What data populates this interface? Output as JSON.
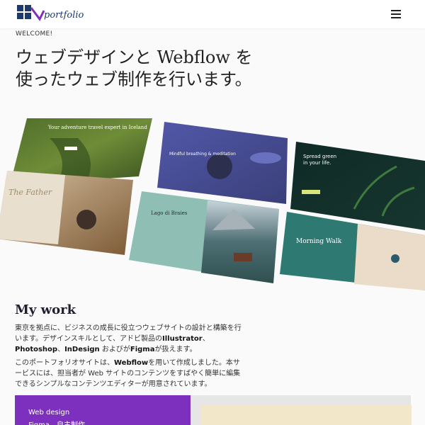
{
  "header": {
    "logo_text": "portfolio",
    "menu_icon": "hamburger-menu-icon"
  },
  "hero": {
    "welcome": "WELCOME!",
    "headline_line1": "ウェブデザインと Webflow を",
    "headline_line2": "使ったウェブ制作を行います。"
  },
  "collage": {
    "panels": [
      {
        "name": "iceland-panel",
        "title": "Your adventure travel expert in Iceland"
      },
      {
        "name": "meditation-panel",
        "title": "Mindful breathing & meditation"
      },
      {
        "name": "spread-green-panel",
        "title_line1": "Spread green",
        "title_line2": "in your life."
      },
      {
        "name": "the-father-panel",
        "title": "The Father"
      },
      {
        "name": "lago-di-braies-panel",
        "title": "Lago di Braies"
      },
      {
        "name": "morning-walk-panel",
        "title": "Morning Walk"
      }
    ]
  },
  "mywork": {
    "title": "My work",
    "para1_a": "東京を拠点に、ビジネスの成長に役立つウェブサイトの設計と構築を行います。デザインスキルとして、アドビ製品の",
    "para1_illustrator": "Illustrator",
    "para1_b": "、",
    "para1_photoshop": "Photoshop",
    "para1_c": "、",
    "para1_indesign": "InDesign",
    "para1_d": " およびが",
    "para1_figma": "Figma",
    "para1_e": "が扱えます。",
    "para2_a": "このポートフォリオサイトは、",
    "para2_webflow": "Webflow",
    "para2_b": "を用いて作成しました。本サービスには、担当者が Web サイトのコンテンツをすばやく簡単に編集できるシンプルなコンテンツエディターが用意されています。"
  },
  "cards": {
    "purple_line1": "Web design",
    "purple_line2": "Figma、自主制作"
  }
}
